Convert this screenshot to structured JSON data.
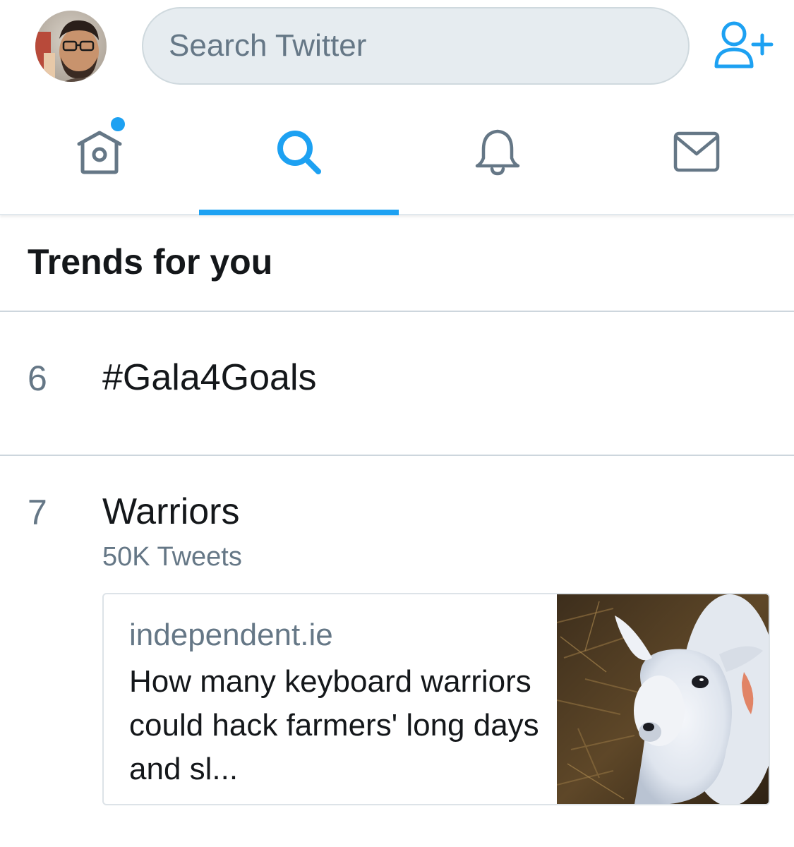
{
  "header": {
    "search_placeholder": "Search Twitter"
  },
  "tabs": [
    {
      "icon": "home-icon",
      "has_notification_dot": true
    },
    {
      "icon": "search-icon",
      "active": true
    },
    {
      "icon": "bell-icon"
    },
    {
      "icon": "mail-icon"
    }
  ],
  "trends": {
    "title": "Trends for you",
    "items": [
      {
        "rank": "6",
        "name": "#Gala4Goals"
      },
      {
        "rank": "7",
        "name": "Warriors",
        "count": "50K Tweets",
        "card": {
          "domain": "independent.ie",
          "title": "How many keyboard warriors could hack farmers' long days and sl...",
          "image": "lamb-photo"
        }
      }
    ]
  },
  "colors": {
    "accent": "#1da1f2",
    "icon_gray": "#657786",
    "text_primary": "#14171a",
    "search_bg": "#e6ecf0"
  }
}
